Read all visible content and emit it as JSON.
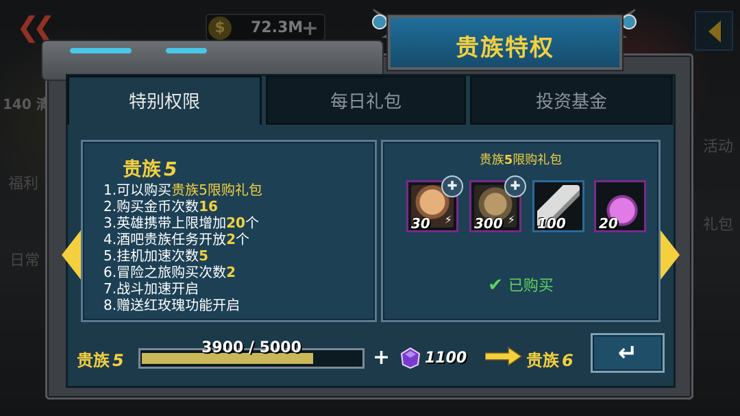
{
  "hud": {
    "back_glyph": "❮❮",
    "coins": "72.3M",
    "coin_plus": "+",
    "badge": "140 清",
    "side_labels": [
      "福利",
      "日常",
      "活动",
      "礼包"
    ]
  },
  "title": "贵族特权",
  "tabs": [
    "特别权限",
    "每日礼包",
    "投资基金"
  ],
  "active_tab": 0,
  "perk_panel": {
    "vip_label": "贵族",
    "vip_level": "5",
    "perks": [
      {
        "prefix": "1.可以购买",
        "highlight": "贵族5限购礼包",
        "suffix": ""
      },
      {
        "prefix": "2.购买金币次数",
        "highlight": "16",
        "suffix": ""
      },
      {
        "prefix": "3.英雄携带上限增加",
        "highlight": "20",
        "suffix": "个"
      },
      {
        "prefix": "4.酒吧贵族任务开放",
        "highlight": "2",
        "suffix": "个"
      },
      {
        "prefix": "5.挂机加速次数",
        "highlight": "5",
        "suffix": ""
      },
      {
        "prefix": "6.冒险之旅购买次数",
        "highlight": "2",
        "suffix": ""
      },
      {
        "prefix": "7.战斗加速开启",
        "highlight": "",
        "suffix": ""
      },
      {
        "prefix": "8.赠送红玫瑰功能开启",
        "highlight": "",
        "suffix": ""
      }
    ]
  },
  "gift_panel": {
    "title_prefix": "贵族",
    "title_level": "5",
    "title_suffix": "限购礼包",
    "items": [
      {
        "name": "hero-shard-1",
        "qty": "30",
        "frame": "purple",
        "has_puzzle": true,
        "has_bolt": true
      },
      {
        "name": "hero-shard-2",
        "qty": "300",
        "frame": "purple",
        "has_puzzle": true,
        "has_bolt": true
      },
      {
        "name": "tube",
        "qty": "100",
        "frame": "blue",
        "has_puzzle": false,
        "has_bolt": false
      },
      {
        "name": "potion",
        "qty": "20",
        "frame": "purple",
        "has_puzzle": false,
        "has_bolt": false
      }
    ],
    "status": "已购买"
  },
  "progress": {
    "current_label": "贵族",
    "current_level": "5",
    "value_text": "3900 / 5000",
    "fraction": 0.78,
    "plus": "+",
    "gem_count": "1100",
    "next_label": "贵族",
    "next_level": "6"
  },
  "colors": {
    "gold": "#f4d03f",
    "panel": "#1d4055",
    "purchased_green": "#5fd35f"
  }
}
